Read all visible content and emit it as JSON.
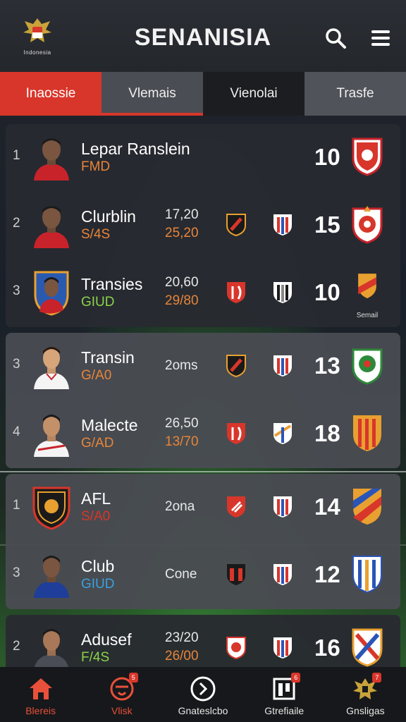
{
  "app": {
    "title": "SENANISIA",
    "logo_text": "Indonesia"
  },
  "colors": {
    "accent": "#d8362b",
    "position_orange": "#e8853a",
    "position_blue": "#3aa0e0",
    "position_green": "#8bd24a"
  },
  "tabs": [
    {
      "label": "Inaossie"
    },
    {
      "label": "Vlemais"
    },
    {
      "label": "Vienolai"
    },
    {
      "label": "Trasfe"
    }
  ],
  "rows": [
    {
      "rank": "1",
      "name": "Lepar Ranslein",
      "position": "FMD",
      "pos_color": "#e8853a",
      "stat_top": "",
      "stat_bottom": "",
      "stat_mid": "",
      "score": "10",
      "crest_label": "",
      "avatar": "player-red"
    },
    {
      "rank": "2",
      "name": "Clurblin",
      "position": "S/4S",
      "pos_color": "#e8853a",
      "stat_top": "17,20",
      "stat_bottom": "25,20",
      "stat_mid": "",
      "score": "15",
      "crest_label": "",
      "avatar": "player-red"
    },
    {
      "rank": "3",
      "name": "Transies",
      "position": "GIUD",
      "pos_color": "#8bd24a",
      "stat_top": "20,60",
      "stat_bottom": "29/80",
      "stat_mid": "",
      "score": "10",
      "crest_label": "Semail",
      "avatar": "player-shield"
    },
    {
      "rank": "3",
      "name": "Transin",
      "position": "G/A0",
      "pos_color": "#e8853a",
      "stat_top": "",
      "stat_bottom": "",
      "stat_mid": "2oms",
      "score": "13",
      "crest_label": "",
      "avatar": "player-white"
    },
    {
      "rank": "4",
      "name": "Malecte",
      "position": "G/AD",
      "pos_color": "#e8853a",
      "stat_top": "26,50",
      "stat_bottom": "13/70",
      "stat_mid": "",
      "score": "18",
      "crest_label": "",
      "avatar": "player-white"
    },
    {
      "rank": "1",
      "name": "AFL",
      "position": "S/A0",
      "pos_color": "#d8362b",
      "stat_top": "",
      "stat_bottom": "",
      "stat_mid": "2ona",
      "score": "14",
      "crest_label": "",
      "avatar": "club-crest"
    },
    {
      "rank": "3",
      "name": "Club",
      "position": "GIUD",
      "pos_color": "#3aa0e0",
      "stat_top": "",
      "stat_bottom": "",
      "stat_mid": "Cone",
      "score": "12",
      "crest_label": "",
      "avatar": "player-blue"
    },
    {
      "rank": "2",
      "name": "Adusef",
      "position": "F/4S",
      "pos_color": "#8bd24a",
      "stat_top": "23/20",
      "stat_bottom": "26/00",
      "stat_mid": "",
      "score": "16",
      "crest_label": "",
      "avatar": "player-grey"
    }
  ],
  "bottom_nav": [
    {
      "label": "Blereis",
      "icon": "home-icon",
      "badge": ""
    },
    {
      "label": "Vlisk",
      "icon": "club-icon",
      "badge": "5"
    },
    {
      "label": "Gnateslcbo",
      "icon": "arrow-circle-icon",
      "badge": ""
    },
    {
      "label": "Gtrefiaile",
      "icon": "grid-icon",
      "badge": "6"
    },
    {
      "label": "Gnsligas",
      "icon": "eagle-icon",
      "badge": "7"
    }
  ]
}
